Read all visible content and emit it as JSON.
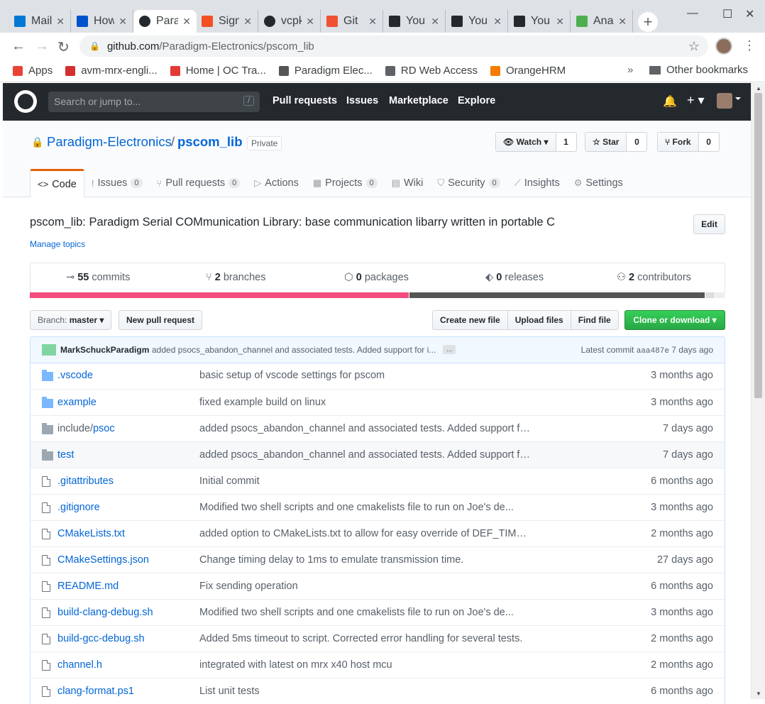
{
  "browser": {
    "tabs": [
      {
        "label": "Mail",
        "icon": "outlook-icon",
        "color": "#0078d4"
      },
      {
        "label": "How",
        "icon": "atlassian-icon",
        "color": "#0052cc"
      },
      {
        "label": "Paradigm",
        "icon": "github-icon",
        "color": "#24292e"
      },
      {
        "label": "Sign",
        "icon": "microsoft-icon",
        "color": "#f25022"
      },
      {
        "label": "vcpkg",
        "icon": "github-icon",
        "color": "#24292e"
      },
      {
        "label": "Git",
        "icon": "git-icon",
        "color": "#f05033"
      },
      {
        "label": "You",
        "icon": "ycombinator-icon",
        "color": "#24292e"
      },
      {
        "label": "You",
        "icon": "ycombinator-icon",
        "color": "#24292e"
      },
      {
        "label": "You",
        "icon": "ycombinator-icon",
        "color": "#24292e"
      },
      {
        "label": "Ana",
        "icon": "frog-icon",
        "color": "#4caf50"
      }
    ],
    "url_host": "github.com",
    "url_path": "/Paradigm-Electronics/pscom_lib",
    "bookmarks": [
      {
        "label": "Apps",
        "color": "#ea4335"
      },
      {
        "label": "avm-mrx-engli...",
        "color": "#d32f2f"
      },
      {
        "label": "Home | OC Tra...",
        "color": "#e53935"
      },
      {
        "label": "Paradigm Elec...",
        "color": "#555555"
      },
      {
        "label": "RD Web Access",
        "color": "#5f6368"
      },
      {
        "label": "OrangeHRM",
        "color": "#f57c00"
      }
    ],
    "other_bookmarks": "Other bookmarks"
  },
  "gh": {
    "search_placeholder": "Search or jump to...",
    "search_key": "/",
    "nav": [
      "Pull requests",
      "Issues",
      "Marketplace",
      "Explore"
    ]
  },
  "repo": {
    "owner": "Paradigm-Electronics",
    "separator": "/",
    "name": "pscom_lib",
    "visibility": "Private",
    "watch_label": "Watch",
    "watch_count": "1",
    "star_label": "Star",
    "star_count": "0",
    "fork_label": "Fork",
    "fork_count": "0",
    "tabs": [
      {
        "label": "Code",
        "icon": "<>",
        "count": null
      },
      {
        "label": "Issues",
        "icon": "!",
        "count": "0"
      },
      {
        "label": "Pull requests",
        "icon": "⑂",
        "count": "0"
      },
      {
        "label": "Actions",
        "icon": "▷",
        "count": null
      },
      {
        "label": "Projects",
        "icon": "▦",
        "count": "0"
      },
      {
        "label": "Wiki",
        "icon": "▤",
        "count": null
      },
      {
        "label": "Security",
        "icon": "⛉",
        "count": "0"
      },
      {
        "label": "Insights",
        "icon": "⟋",
        "count": null
      },
      {
        "label": "Settings",
        "icon": "⚙",
        "count": null
      }
    ],
    "description": "pscom_lib: Paradigm Serial COMmunication Library: base communication libarry written in portable C",
    "manage_topics": "Manage topics",
    "edit_label": "Edit",
    "summary": {
      "commits_count": "55",
      "commits_label": "commits",
      "branches_count": "2",
      "branches_label": "branches",
      "packages_count": "0",
      "packages_label": "packages",
      "releases_count": "0",
      "releases_label": "releases",
      "contributors_count": "2",
      "contributors_label": "contributors"
    },
    "languages": [
      {
        "share": 54.6,
        "color": "#f34b7d"
      },
      {
        "share": 42.5,
        "color": "#555555"
      },
      {
        "share": 1.5,
        "color": "#dddddd"
      },
      {
        "share": 1.4,
        "color": "#eeeeee"
      }
    ],
    "branch_prefix": "Branch:",
    "branch": "master",
    "new_pr": "New pull request",
    "create_file": "Create new file",
    "upload_files": "Upload files",
    "find_file": "Find file",
    "clone": "Clone or download",
    "commit": {
      "author": "MarkSchuckParadigm",
      "message": "added psocs_abandon_channel and associated tests. Added support for i...",
      "more": "...",
      "latest_label": "Latest commit",
      "sha": "aaa487e",
      "age": "7 days ago"
    },
    "files": [
      {
        "type": "dir",
        "name": ".vscode",
        "msg": "basic setup of vscode settings for pscom",
        "age": "3 months ago"
      },
      {
        "type": "dir",
        "name": "example",
        "msg": "fixed example build on linux",
        "age": "3 months ago"
      },
      {
        "type": "dir-grey",
        "name_prefix": "include/",
        "name": "psoc",
        "msg": "added psocs_abandon_channel and associated tests. Added support for i...",
        "age": "7 days ago"
      },
      {
        "type": "dir-grey",
        "name": "test",
        "msg": "added psocs_abandon_channel and associated tests. Added support for i...",
        "age": "7 days ago",
        "highlight": true
      },
      {
        "type": "file",
        "name": ".gitattributes",
        "msg": "Initial commit",
        "age": "6 months ago"
      },
      {
        "type": "file",
        "name": ".gitignore",
        "msg": "Modified two shell scripts and one cmakelists file to run on Joe's de...",
        "age": "3 months ago"
      },
      {
        "type": "file",
        "name": "CMakeLists.txt",
        "msg": "added option to CMakeLists.txt to allow for easy override of DEF_TIMEOUT",
        "age": "2 months ago"
      },
      {
        "type": "file",
        "name": "CMakeSettings.json",
        "msg": "Change timing delay to 1ms to emulate transmission time.",
        "age": "27 days ago"
      },
      {
        "type": "file",
        "name": "README.md",
        "msg": "Fix sending operation",
        "age": "6 months ago"
      },
      {
        "type": "file",
        "name": "build-clang-debug.sh",
        "msg": "Modified two shell scripts and one cmakelists file to run on Joe's de...",
        "age": "3 months ago"
      },
      {
        "type": "file",
        "name": "build-gcc-debug.sh",
        "msg": "Added 5ms timeout to script. Corrected error handling for several tests.",
        "age": "2 months ago"
      },
      {
        "type": "file",
        "name": "channel.h",
        "msg": "integrated with latest on mrx x40 host mcu",
        "age": "2 months ago"
      },
      {
        "type": "file",
        "name": "clang-format.ps1",
        "msg": "List unit tests",
        "age": "6 months ago"
      }
    ]
  }
}
